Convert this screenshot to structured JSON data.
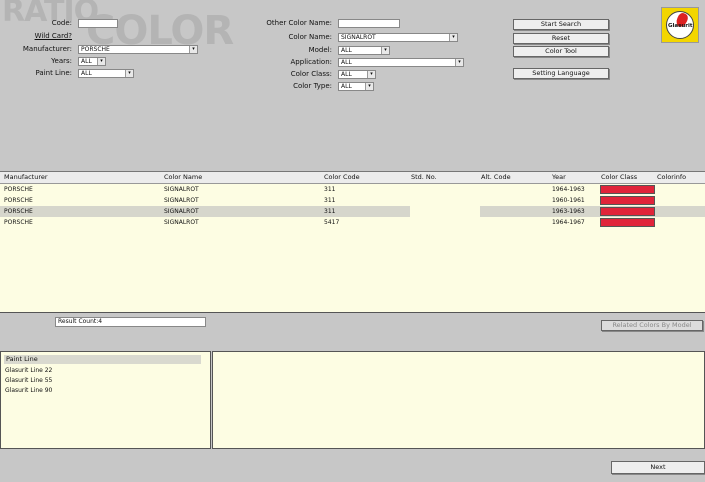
{
  "watermark": {
    "line1": "RATIO",
    "line2": "COLOR"
  },
  "logo": {
    "text": "Glasurit"
  },
  "form_left": {
    "code_label": "Code:",
    "code_value": "",
    "wildcard_label": "Wild Card?",
    "manufacturer_label": "Manufacturer:",
    "manufacturer_value": "PORSCHE",
    "years_label": "Years:",
    "years_value": "ALL",
    "paint_line_label": "Paint Line:",
    "paint_line_value": "ALL"
  },
  "form_mid": {
    "other_color_name_label": "Other Color Name:",
    "other_color_name_value": "",
    "color_name_label": "Color Name:",
    "color_name_value": "SIGNALROT",
    "model_label": "Model:",
    "model_value": "ALL",
    "application_label": "Application:",
    "application_value": "ALL",
    "color_class_label": "Color Class:",
    "color_class_value": "ALL",
    "color_type_label": "Color Type:",
    "color_type_value": "ALL"
  },
  "buttons": {
    "start_search": "Start Search",
    "reset": "Reset",
    "color_tool": "Color Tool",
    "setting_language": "Setting Language",
    "related_colors": "Related Colors By Model",
    "next": "Next"
  },
  "results": {
    "columns": [
      "Manufacturer",
      "Color Name",
      "Color Code",
      "Std. No.",
      "Alt. Code",
      "Year",
      "Color Class",
      "Colorinfo"
    ],
    "rows": [
      {
        "manufacturer": "PORSCHE",
        "color_name": "SIGNALROT",
        "color_code": "311",
        "std_no": "",
        "alt_code": "",
        "year": "1964-1963",
        "swatch": "#e0243a",
        "selected": false
      },
      {
        "manufacturer": "PORSCHE",
        "color_name": "SIGNALROT",
        "color_code": "311",
        "std_no": "",
        "alt_code": "",
        "year": "1960-1961",
        "swatch": "#e0243a",
        "selected": false
      },
      {
        "manufacturer": "PORSCHE",
        "color_name": "SIGNALROT",
        "color_code": "311",
        "std_no": "",
        "alt_code": "",
        "year": "1963-1963",
        "swatch": "#e0243a",
        "selected": true
      },
      {
        "manufacturer": "PORSCHE",
        "color_name": "SIGNALROT",
        "color_code": "5417",
        "std_no": "",
        "alt_code": "",
        "year": "1964-1967",
        "swatch": "#e0243a",
        "selected": false
      }
    ]
  },
  "result_count": {
    "text": "Result Count:4"
  },
  "paint_line_panel": {
    "header": "Paint Line",
    "items": [
      "Glasurit Line 22",
      "Glasurit Line 55",
      "Glasurit Line 90"
    ]
  },
  "colors": {
    "swatch_red": "#e0243a",
    "panel_bg": "#fdfde3",
    "selected_row": "#d6d6cc"
  }
}
